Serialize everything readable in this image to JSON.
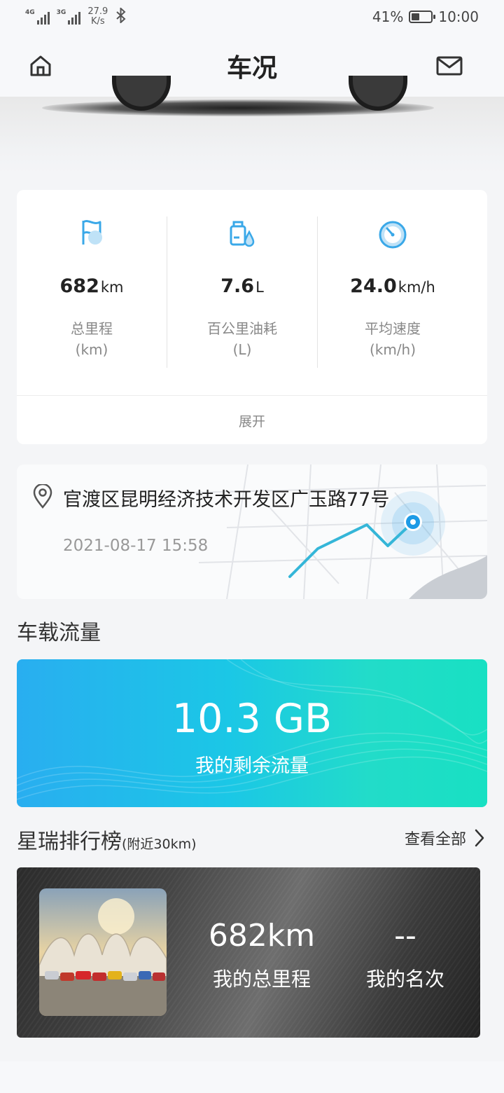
{
  "status_bar": {
    "network1": "4G",
    "network2": "3G",
    "speed_value": "27.9",
    "speed_unit": "K/s",
    "battery": "41%",
    "battery_level": 0.41,
    "time": "10:00"
  },
  "header": {
    "title": "车况",
    "home_icon": "home-icon",
    "mail_icon": "mail-icon"
  },
  "stats": [
    {
      "icon": "flag-icon",
      "value": "682",
      "unit": "km",
      "label": "总里程",
      "label_unit": "(km)"
    },
    {
      "icon": "fuel-icon",
      "value": "7.6",
      "unit": "L",
      "label": "百公里油耗",
      "label_unit": "(L)"
    },
    {
      "icon": "speedometer-icon",
      "value": "24.0",
      "unit": "km/h",
      "label": "平均速度",
      "label_unit": "(km/h)"
    }
  ],
  "expand_label": "展开",
  "location": {
    "address": "官渡区昆明经济技术开发区广玉路77号",
    "time": "2021-08-17 15:58"
  },
  "data_section": {
    "title": "车载流量",
    "value": "10.3 GB",
    "label": "我的剩余流量"
  },
  "ranking": {
    "title": "星瑞排行榜",
    "subtitle": "(附近30km)",
    "view_all": "查看全部",
    "mileage_value": "682km",
    "mileage_label": "我的总里程",
    "rank_value": "--",
    "rank_label": "我的名次"
  },
  "colors": {
    "accent_blue": "#3aa8e8",
    "data_card_start": "#29aef0",
    "data_card_end": "#18e0c3"
  }
}
